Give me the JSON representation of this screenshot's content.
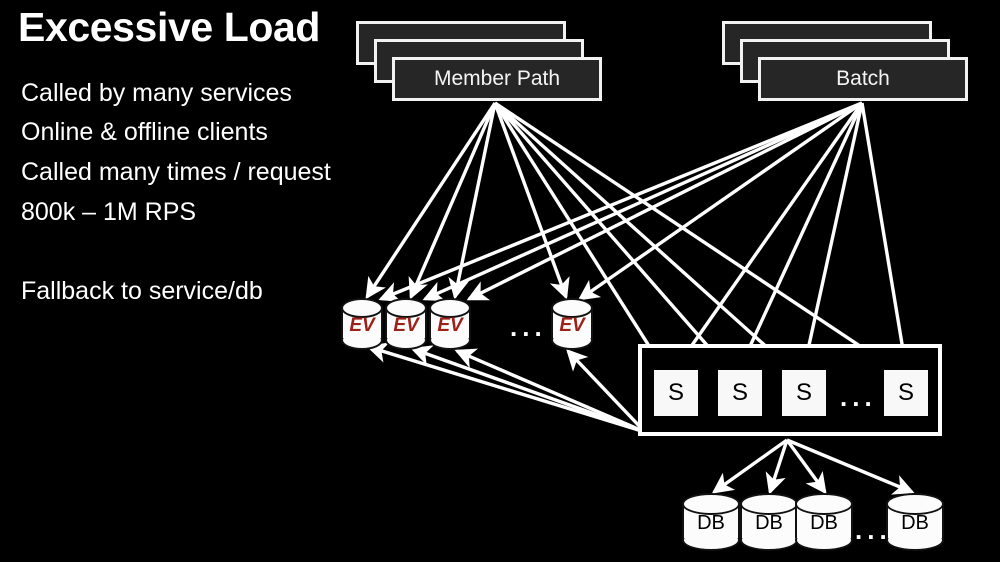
{
  "slide": {
    "title": "Excessive Load",
    "background_color": "#000000",
    "text_color": "#ffffff",
    "bullets": [
      "Called by many services",
      "Online & offline clients",
      "Called many times / request",
      "800k – 1M RPS",
      "Fallback to service/db"
    ]
  },
  "diagram": {
    "clients": [
      {
        "label": "Member Path",
        "stack_count": 3
      },
      {
        "label": "Batch",
        "stack_count": 3
      }
    ],
    "cache_tier": {
      "node_label": "EV",
      "node_color": "#9c2118",
      "count_shown": 4,
      "ellipsis": "..."
    },
    "service_tier": {
      "node_label": "S",
      "count_shown": 4,
      "ellipsis": "...",
      "border_color": "#ffffff"
    },
    "db_tier": {
      "node_label": "DB",
      "count_shown": 4,
      "ellipsis": "..."
    },
    "arrow_color": "#ffffff"
  }
}
